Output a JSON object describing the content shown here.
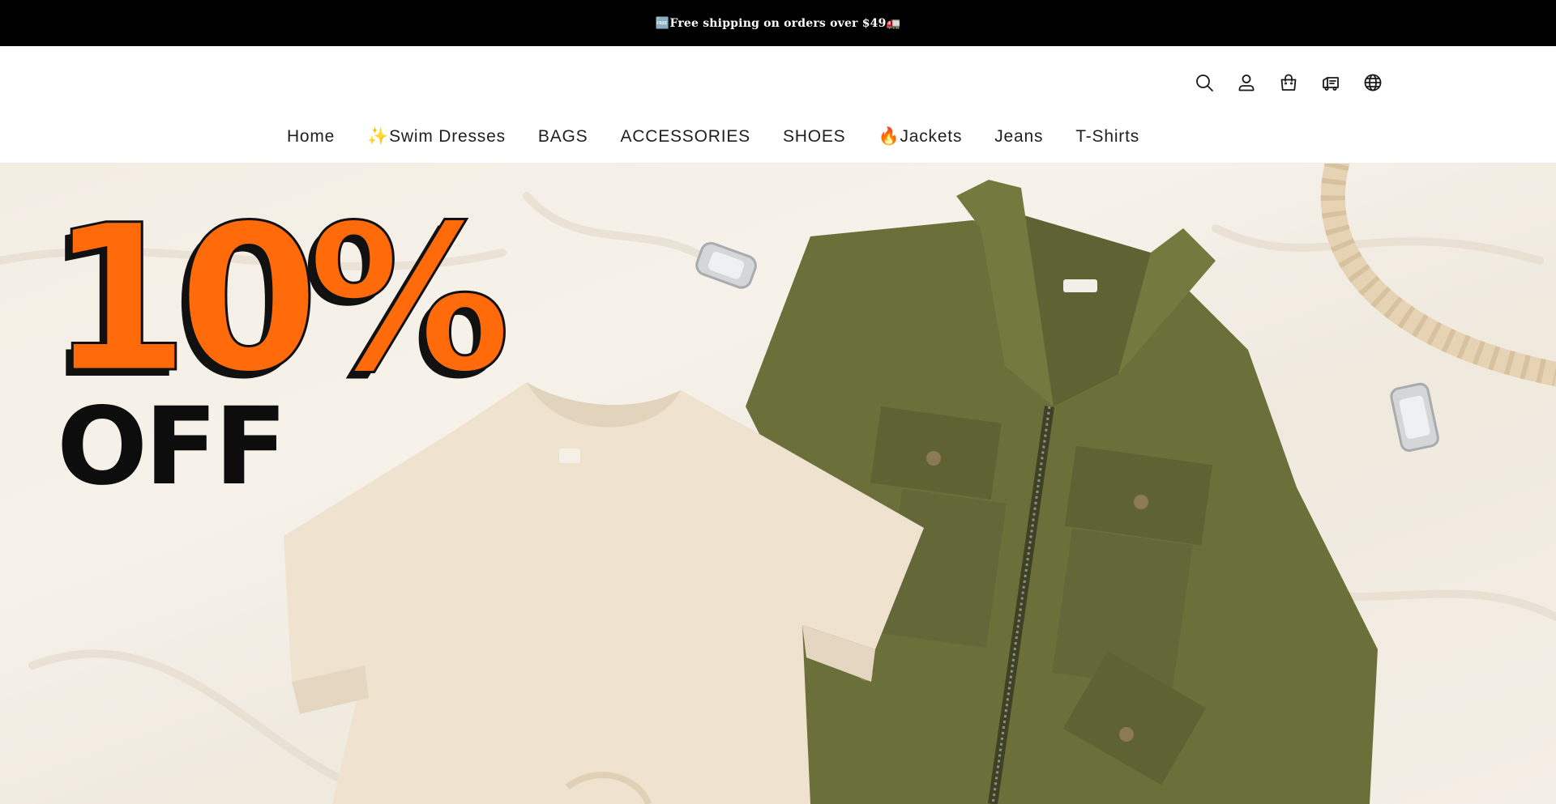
{
  "announcement": {
    "text": "🆓Free shipping on orders over $49🚛"
  },
  "header": {
    "icons": [
      "search-icon",
      "account-icon",
      "cart-icon",
      "order-tracking-icon",
      "language-icon"
    ]
  },
  "nav": {
    "items": [
      {
        "label": "Home"
      },
      {
        "label": "✨Swim Dresses"
      },
      {
        "label": "BAGS"
      },
      {
        "label": "ACCESSORIES"
      },
      {
        "label": "SHOES"
      },
      {
        "label": "🔥Jackets"
      },
      {
        "label": "Jeans"
      },
      {
        "label": "T-Shirts"
      }
    ]
  },
  "hero": {
    "discount": "10%",
    "discount_suffix": "OFF",
    "colors": {
      "accent": "#ff6b0a",
      "jacket": "#6b6f3a",
      "tee": "#efe3d0",
      "background": "#f4efe6"
    }
  }
}
